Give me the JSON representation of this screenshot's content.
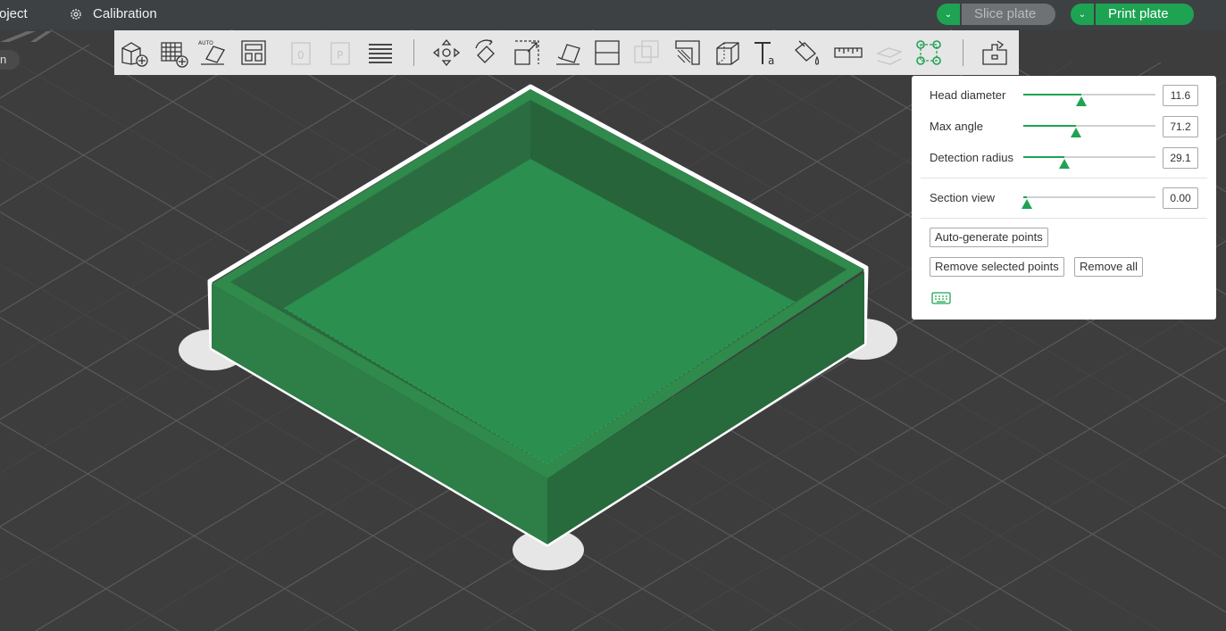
{
  "menu": {
    "project_label": "oject",
    "calibration_label": "Calibration"
  },
  "actions": {
    "slice_label": "Slice plate",
    "print_label": "Print plate"
  },
  "viewport": {
    "partial_label": "n"
  },
  "toolbar": {
    "tools": [
      {
        "name": "add-object-icon"
      },
      {
        "name": "add-plate-icon"
      },
      {
        "name": "auto-orient-icon"
      },
      {
        "name": "arrange-icon"
      },
      {
        "name": "split-objects-icon"
      },
      {
        "name": "split-parts-icon"
      },
      {
        "name": "layers-icon"
      },
      {
        "name": "move-icon"
      },
      {
        "name": "rotate-icon"
      },
      {
        "name": "scale-icon"
      },
      {
        "name": "lay-on-face-icon"
      },
      {
        "name": "cut-icon"
      },
      {
        "name": "boolean-icon"
      },
      {
        "name": "support-paint-icon"
      },
      {
        "name": "seam-paint-icon"
      },
      {
        "name": "text-icon"
      },
      {
        "name": "color-paint-icon"
      },
      {
        "name": "measure-icon"
      },
      {
        "name": "assembly-icon"
      },
      {
        "name": "brim-ears-icon"
      },
      {
        "name": "assembly-view-icon"
      }
    ]
  },
  "panel": {
    "head_diameter": {
      "label": "Head diameter",
      "value": "11.6",
      "fraction": 0.44
    },
    "max_angle": {
      "label": "Max angle",
      "value": "71.2",
      "fraction": 0.4
    },
    "detection_radius": {
      "label": "Detection radius",
      "value": "29.1",
      "fraction": 0.31
    },
    "section_view": {
      "label": "Section view",
      "value": "0.00",
      "fraction": 0.03
    },
    "auto_generate_label": "Auto-generate points",
    "remove_selected_label": "Remove selected points",
    "remove_all_label": "Remove all",
    "keyboard_icon": "keyboard-icon"
  },
  "colors": {
    "accent": "#1ea353",
    "model_green": "#2b8c4f",
    "topbar": "#3d4143",
    "background": "#3c3c3c"
  }
}
